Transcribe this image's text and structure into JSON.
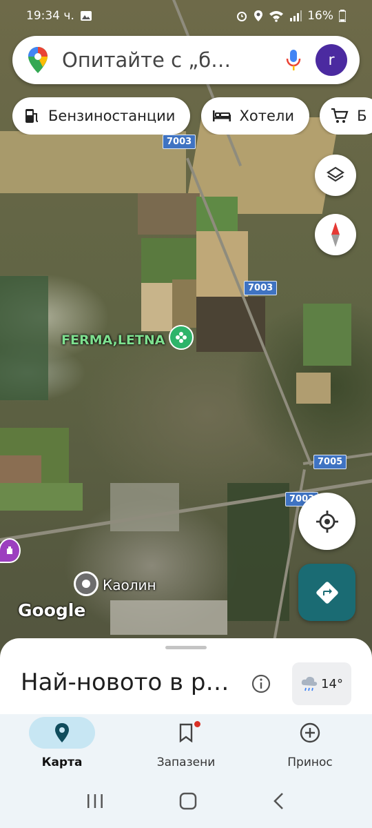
{
  "status_bar": {
    "time": "19:34 ч.",
    "battery": "16%"
  },
  "search": {
    "placeholder": "Опитайте с „б…",
    "avatar_letter": "r"
  },
  "chips": [
    {
      "label": "Бензиностанции",
      "icon": "gas-station-icon"
    },
    {
      "label": "Хотели",
      "icon": "bed-icon"
    },
    {
      "label": "Б",
      "icon": "cart-icon"
    }
  ],
  "map": {
    "road_shields": [
      "7003",
      "7003",
      "7005",
      "7003"
    ],
    "poi_label": "FERMA,LETNA",
    "place_label": "Каолин",
    "attribution": "Google"
  },
  "sheet": {
    "title": "Най-новото в р…",
    "weather_temp": "14°"
  },
  "bottom_nav": [
    {
      "label": "Карта",
      "icon": "map-pin-icon",
      "active": true
    },
    {
      "label": "Запазени",
      "icon": "bookmark-icon",
      "active": false
    },
    {
      "label": "Принос",
      "icon": "add-circle-icon",
      "active": false
    }
  ],
  "colors": {
    "accent_teal": "#1a6b73",
    "avatar_purple": "#4b2aa0",
    "shield_blue": "#3f73c2",
    "active_nav": "#c7e6f3"
  }
}
